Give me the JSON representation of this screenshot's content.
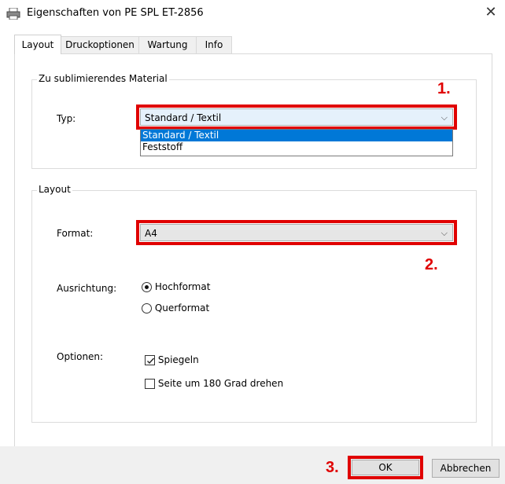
{
  "window": {
    "title": "Eigenschaften von PE SPL ET-2856",
    "icon": "printer-icon"
  },
  "tabs": [
    {
      "label": "Layout",
      "active": true
    },
    {
      "label": "Druckoptionen",
      "active": false
    },
    {
      "label": "Wartung",
      "active": false
    },
    {
      "label": "Info",
      "active": false
    }
  ],
  "material_group": {
    "title": "Zu sublimierendes Material",
    "typ_label": "Typ:",
    "typ_value": "Standard / Textil",
    "options": [
      "Standard / Textil",
      "Feststoff"
    ],
    "selected_option": "Standard / Textil"
  },
  "layout_group": {
    "title": "Layout",
    "format_label": "Format:",
    "format_value": "A4",
    "ausrichtung_label": "Ausrichtung:",
    "hochformat_label": "Hochformat",
    "hochformat_selected": true,
    "querformat_label": "Querformat",
    "querformat_selected": false,
    "optionen_label": "Optionen:",
    "spiegeln_label": "Spiegeln",
    "spiegeln_checked": true,
    "drehen_label": "Seite um 180 Grad drehen",
    "drehen_checked": false
  },
  "annotations": {
    "step1": "1.",
    "step2": "2.",
    "step3": "3."
  },
  "buttons": {
    "ok": "OK",
    "cancel": "Abbrechen"
  },
  "colors": {
    "highlight_red": "#e00000",
    "selection_blue": "#0078d7",
    "combo_bg": "#e5f1fb"
  }
}
